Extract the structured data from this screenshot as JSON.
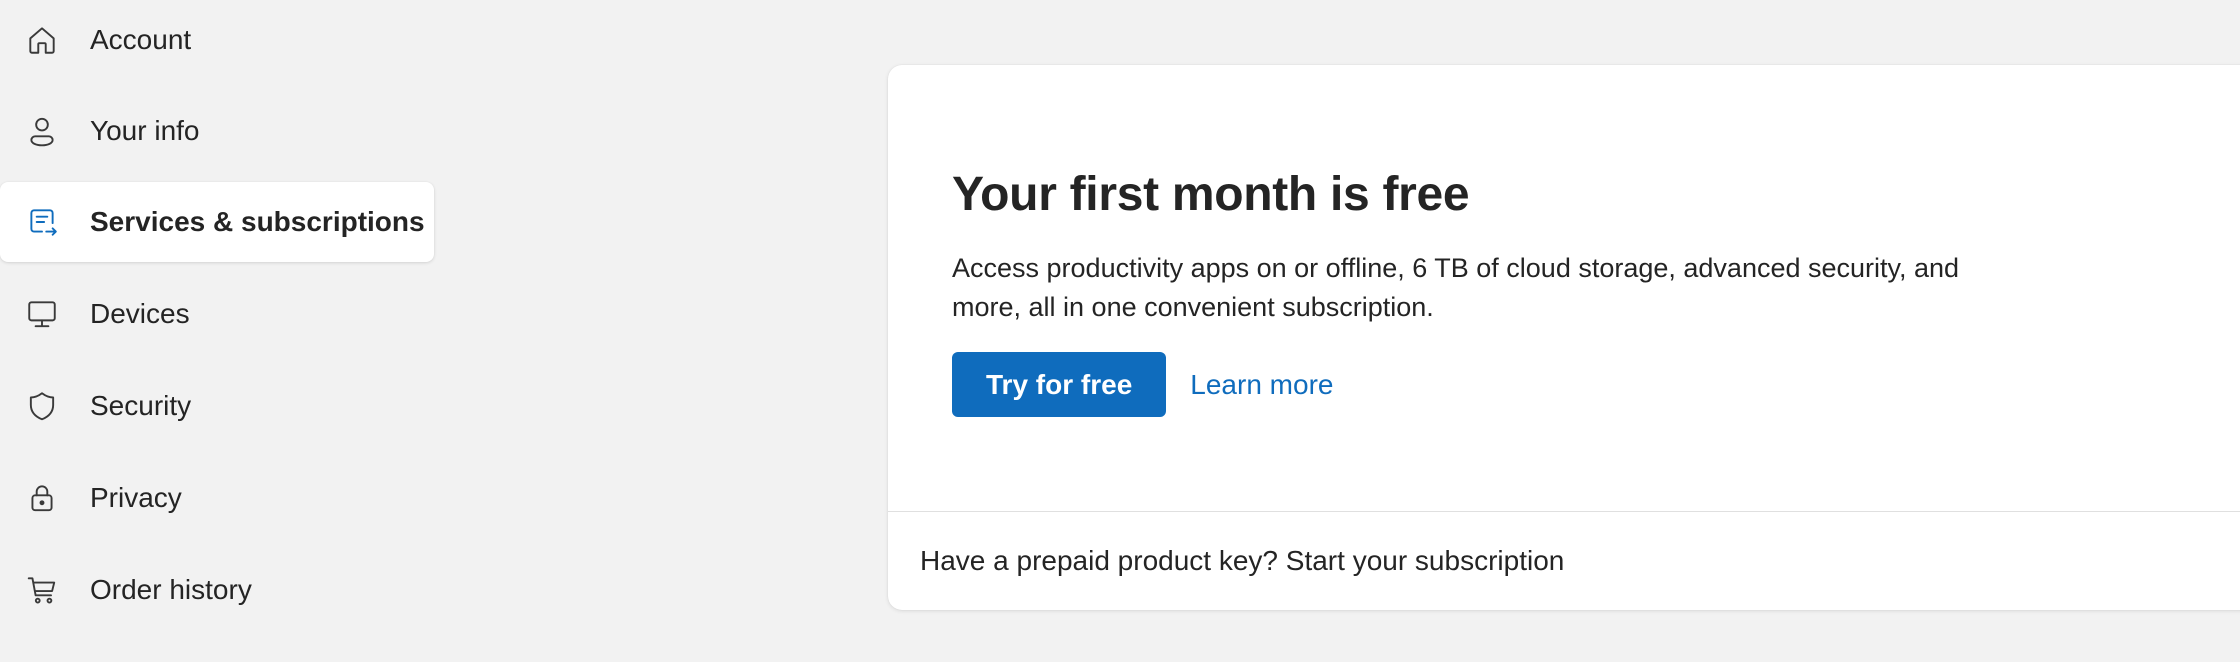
{
  "sidebar": {
    "items": [
      {
        "label": "Account",
        "icon": "home-icon",
        "active": false
      },
      {
        "label": "Your info",
        "icon": "person-icon",
        "active": false
      },
      {
        "label": "Services & subscriptions",
        "icon": "subscription-icon",
        "active": true
      },
      {
        "label": "Devices",
        "icon": "desktop-icon",
        "active": false
      },
      {
        "label": "Security",
        "icon": "shield-icon",
        "active": false
      },
      {
        "label": "Privacy",
        "icon": "lock-icon",
        "active": false
      },
      {
        "label": "Order history",
        "icon": "cart-icon",
        "active": false
      }
    ]
  },
  "promo": {
    "title": "Your first month is free",
    "description": "Access productivity apps on or offline, 6 TB of cloud storage, advanced security, and more, all in one convenient subscription.",
    "primary_button": "Try for free",
    "secondary_link": "Learn more"
  },
  "footer": {
    "text": "Have a prepaid product key? Start your subscription"
  },
  "colors": {
    "accent": "#0f6cbd",
    "background": "#f2f2f2",
    "card": "#ffffff"
  }
}
